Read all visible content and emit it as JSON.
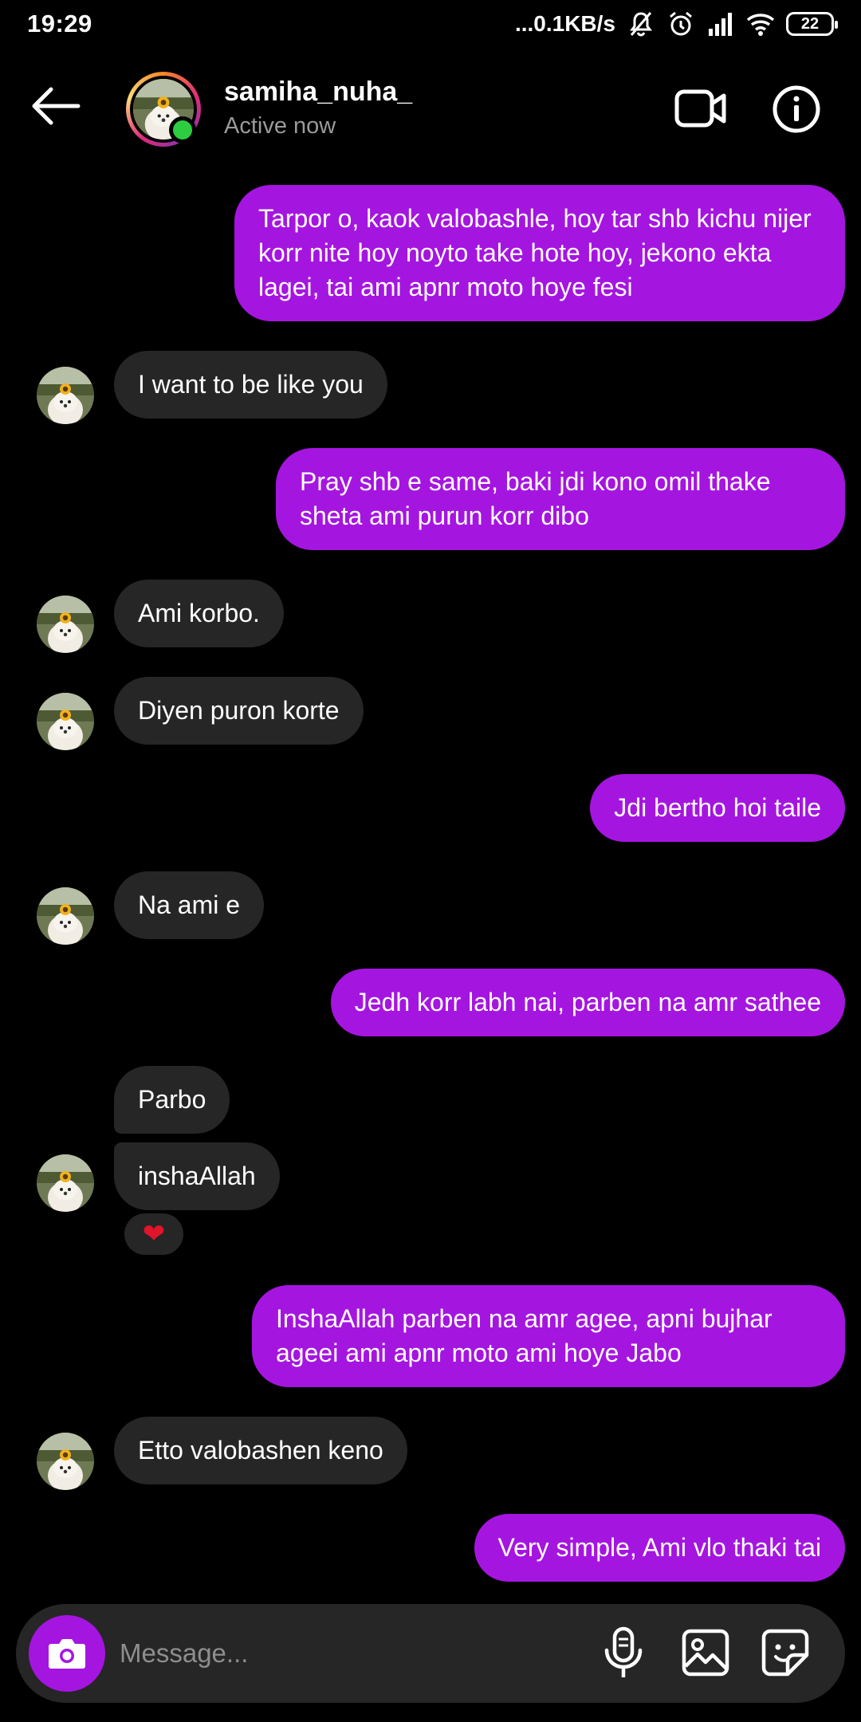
{
  "status_bar": {
    "time": "19:29",
    "network_speed": "...0.1KB/s",
    "battery": "22",
    "icons": [
      "muted-bell-icon",
      "alarm-icon",
      "signal-icon",
      "wifi-icon",
      "battery-icon"
    ]
  },
  "header": {
    "username": "samiha_nuha_",
    "status": "Active now",
    "online": true
  },
  "messages": [
    {
      "from": "me",
      "text": "Tarpor o, kaok valobashle, hoy tar shb kichu nijer korr nite hoy noyto take hote hoy, jekono ekta lagei, tai ami apnr moto hoye fesi"
    },
    {
      "from": "them",
      "text": "I want to be like you"
    },
    {
      "from": "me",
      "text": "Pray shb e same, baki jdi kono omil thake sheta ami purun korr dibo"
    },
    {
      "from": "them",
      "text": "Ami korbo."
    },
    {
      "from": "them",
      "text": "Diyen puron korte"
    },
    {
      "from": "me",
      "text": "Jdi bertho hoi taile"
    },
    {
      "from": "them",
      "text": "Na ami e"
    },
    {
      "from": "me",
      "text": "Jedh korr labh nai, parben na amr sathee"
    },
    {
      "from": "them",
      "text": "Parbo"
    },
    {
      "from": "them",
      "text": "inshaAllah",
      "reaction": "❤"
    },
    {
      "from": "me",
      "text": "InshaAllah parben na amr agee, apni bujhar ageei ami apnr moto ami hoye Jabo"
    },
    {
      "from": "them",
      "text": "Etto valobashen keno"
    },
    {
      "from": "me",
      "text": "Very simple, Ami vlo thaki tai"
    }
  ],
  "composer": {
    "placeholder": "Message..."
  },
  "colors": {
    "sent_bubble": "#a515e0",
    "received_bubble": "#262626",
    "background": "#000000",
    "online": "#2ecc40"
  }
}
